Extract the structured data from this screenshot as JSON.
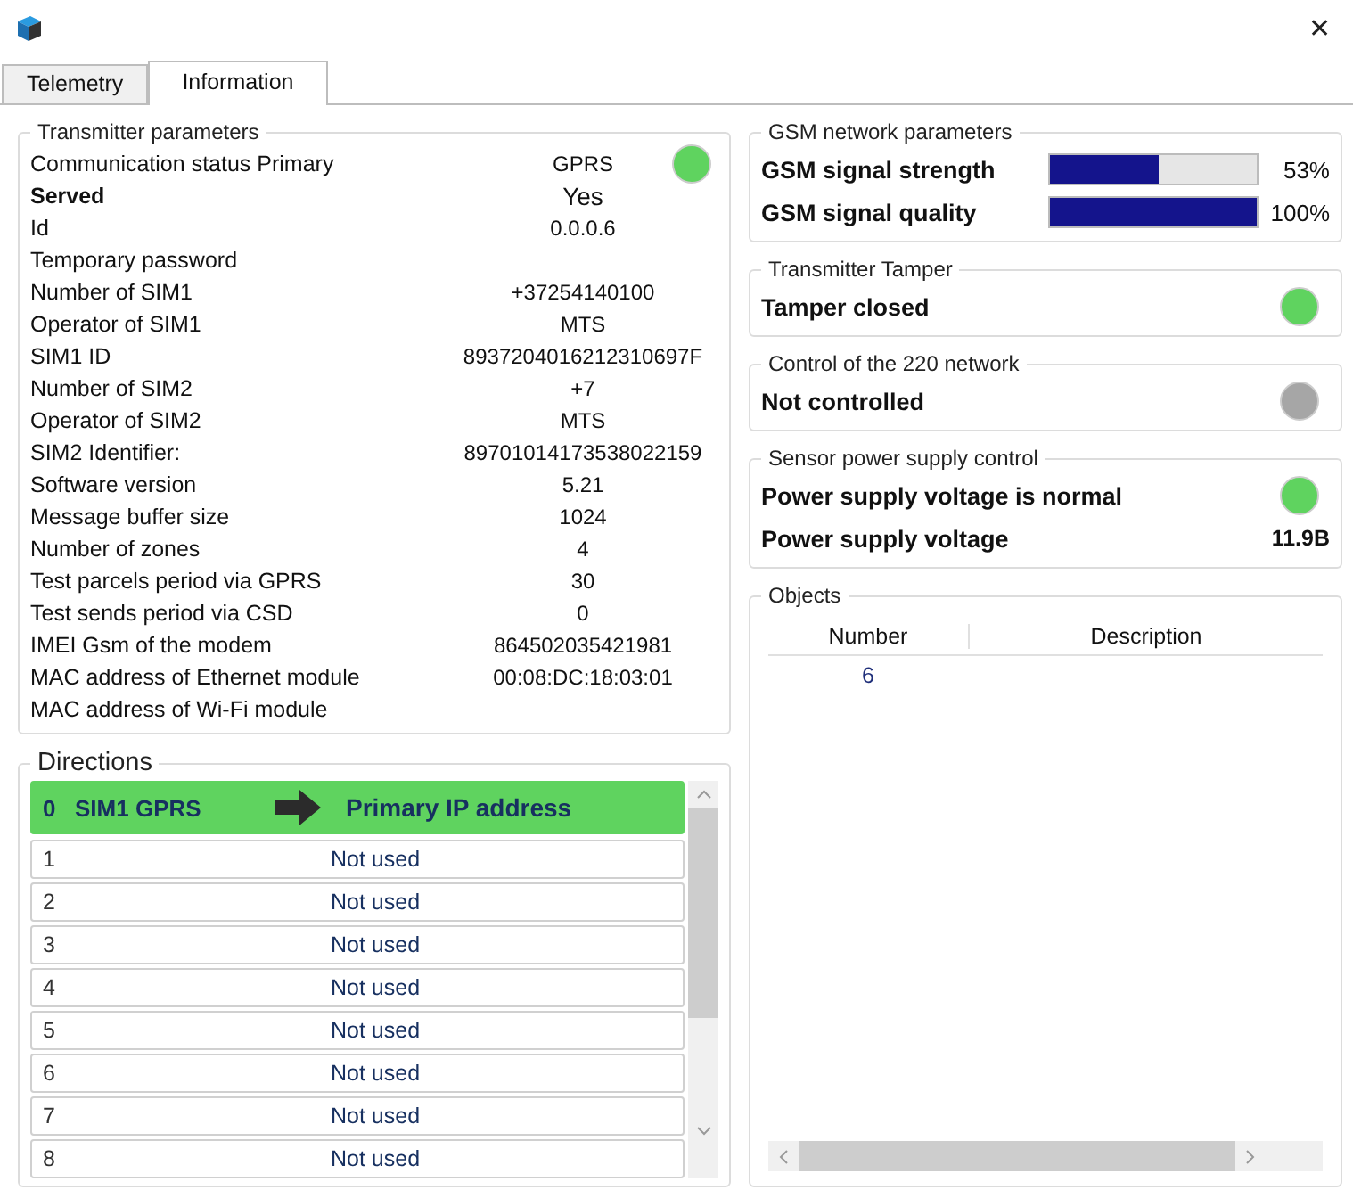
{
  "window": {
    "close": "✕"
  },
  "tabs": [
    {
      "label": "Telemetry",
      "selected": false
    },
    {
      "label": "Information",
      "selected": true
    }
  ],
  "transmitter": {
    "title": "Transmitter parameters",
    "rows": [
      {
        "label": "Communication status Primary",
        "value": "GPRS",
        "color": "#5fd35f"
      },
      {
        "label": "Served",
        "value": "Yes",
        "bold": true
      },
      {
        "label": "Id",
        "value": "0.0.0.6"
      },
      {
        "label": "Temporary password"
      },
      {
        "label": "Number of SIM1",
        "value": "+37254140100"
      },
      {
        "label": "Operator of SIM1",
        "value": "MTS"
      },
      {
        "label": "SIM1 ID",
        "value": "8937204016212310697F"
      },
      {
        "label": "Number of SIM2",
        "value": "+7"
      },
      {
        "label": "Operator of SIM2",
        "value": "MTS"
      },
      {
        "label": "SIM2 Identifier:",
        "value": "89701014173538022159"
      },
      {
        "label": "Software version",
        "value": "5.21"
      },
      {
        "label": "Message buffer size",
        "value": "1024"
      },
      {
        "label": "Number of zones",
        "value": "4"
      },
      {
        "label": "Test parcels period via GPRS",
        "value": "30"
      },
      {
        "label": "Test sends period via CSD",
        "value": "0"
      },
      {
        "label": "IMEI Gsm of the modem",
        "value": "864502035421981"
      },
      {
        "label": "MAC address of Ethernet module",
        "value": "00:08:DC:18:03:01"
      },
      {
        "label": "MAC address of Wi-Fi module"
      }
    ]
  },
  "gsm": {
    "title": "GSM network parameters",
    "meters": [
      {
        "label": "GSM signal strength",
        "level": 0.53,
        "reading": "53%"
      },
      {
        "label": "GSM signal quality",
        "level": 1.0,
        "reading": "100%"
      }
    ]
  },
  "indicator_groups": [
    {
      "title": "Transmitter Tamper",
      "rows": [
        {
          "label": "Tamper closed",
          "color": "#5fd35f"
        }
      ]
    },
    {
      "title": "Control of the 220 network",
      "rows": [
        {
          "label": "Not controlled",
          "color": "#a6a6a6"
        }
      ]
    },
    {
      "title": "Sensor power supply control",
      "rows": [
        {
          "label": "Power supply voltage is normal",
          "color": "#5fd35f"
        },
        {
          "label": "Power supply voltage",
          "value": "11.9B"
        }
      ]
    }
  ],
  "directions": {
    "title": "Directions",
    "rows": [
      {
        "number": "0",
        "channel": "SIM1 GPRS",
        "target": "Primary IP address",
        "selected": true
      },
      {
        "number": "1",
        "target": "Not used",
        "selected": false
      },
      {
        "number": "2",
        "target": "Not used",
        "selected": false
      },
      {
        "number": "3",
        "target": "Not used",
        "selected": false
      },
      {
        "number": "4",
        "target": "Not used",
        "selected": false
      },
      {
        "number": "5",
        "target": "Not used",
        "selected": false
      },
      {
        "number": "6",
        "target": "Not used",
        "selected": false
      },
      {
        "number": "7",
        "target": "Not used",
        "selected": false
      },
      {
        "number": "8",
        "target": "Not used",
        "selected": false
      }
    ]
  },
  "objects": {
    "title": "Objects",
    "columns": [
      "Number",
      "Description"
    ],
    "rows": [
      [
        "6"
      ]
    ]
  }
}
